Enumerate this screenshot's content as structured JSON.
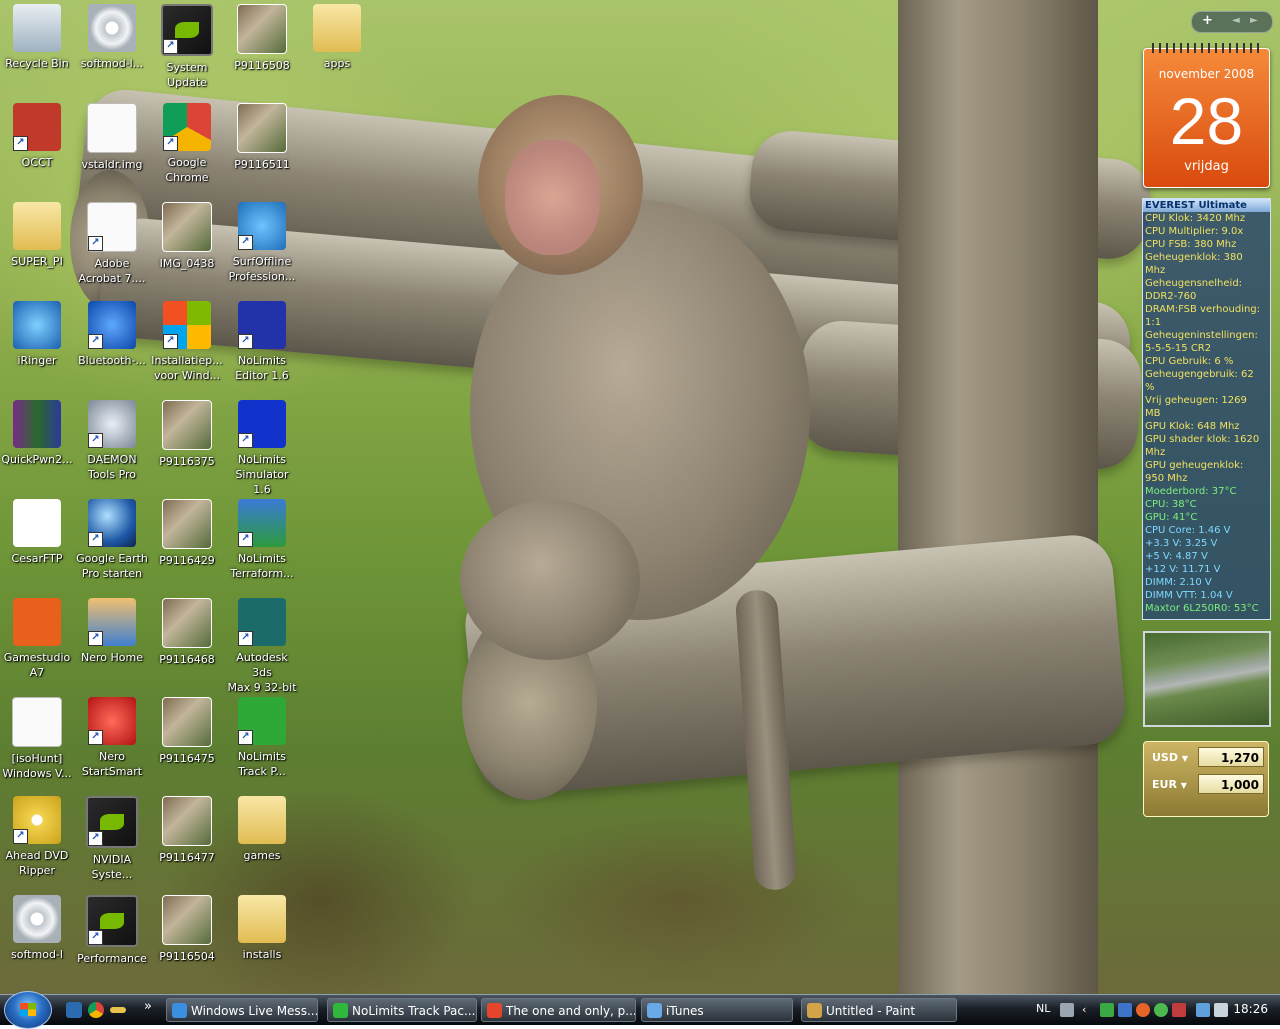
{
  "desktop": {
    "icons": [
      {
        "label": "Recycle Bin"
      },
      {
        "label": "softmod-l..."
      },
      {
        "label": "System\nUpdate"
      },
      {
        "label": "P9116508"
      },
      {
        "label": "apps"
      },
      {
        "label": "OCCT"
      },
      {
        "label": "vstaldr.img"
      },
      {
        "label": "Google\nChrome"
      },
      {
        "label": "P9116511"
      },
      {
        "label": "SUPER_PI"
      },
      {
        "label": "Adobe\nAcrobat 7...."
      },
      {
        "label": "IMG_0438"
      },
      {
        "label": "SurfOffline\nProfession..."
      },
      {
        "label": "iRinger"
      },
      {
        "label": "Bluetooth-..."
      },
      {
        "label": "Installatiep...\nvoor Wind..."
      },
      {
        "label": "NoLimits\nEditor 1.6"
      },
      {
        "label": "QuickPwn2..."
      },
      {
        "label": "DAEMON\nTools Pro"
      },
      {
        "label": "P9116375"
      },
      {
        "label": "NoLimits\nSimulator 1.6"
      },
      {
        "label": "CesarFTP"
      },
      {
        "label": "Google Earth\nPro starten"
      },
      {
        "label": "P9116429"
      },
      {
        "label": "NoLimits\nTerraform..."
      },
      {
        "label": "Gamestudio\nA7"
      },
      {
        "label": "Nero Home"
      },
      {
        "label": "P9116468"
      },
      {
        "label": "Autodesk 3ds\nMax 9 32-bit"
      },
      {
        "label": "[isoHunt]\nWindows V..."
      },
      {
        "label": "Nero\nStartSmart"
      },
      {
        "label": "P9116475"
      },
      {
        "label": "NoLimits\nTrack P..."
      },
      {
        "label": "Ahead DVD\nRipper"
      },
      {
        "label": "NVIDIA\nSyste..."
      },
      {
        "label": "P9116477"
      },
      {
        "label": "games"
      },
      {
        "label": "softmod-l"
      },
      {
        "label": "Performance"
      },
      {
        "label": "P9116504"
      },
      {
        "label": "installs"
      }
    ]
  },
  "calendar": {
    "month": "november 2008",
    "day": "28",
    "weekday": "vrijdag"
  },
  "everest": {
    "title": "EVEREST Ultimate",
    "rows": [
      {
        "text": "CPU Klok: 3420 Mhz",
        "color": "#f0e060"
      },
      {
        "text": "CPU Multiplier: 9.0x",
        "color": "#f0e060"
      },
      {
        "text": "CPU FSB: 380 Mhz",
        "color": "#f0e060"
      },
      {
        "text": "Geheugenklok: 380",
        "color": "#f0e060"
      },
      {
        "text": "Mhz",
        "color": "#f0e060"
      },
      {
        "text": "Geheugensnelheid:",
        "color": "#f0e060"
      },
      {
        "text": "DDR2-760",
        "color": "#f0e060"
      },
      {
        "text": "DRAM:FSB verhouding:",
        "color": "#f0e060"
      },
      {
        "text": "1:1",
        "color": "#f0e060"
      },
      {
        "text": "Geheugeninstellingen:",
        "color": "#f0e060"
      },
      {
        "text": "5-5-5-15 CR2",
        "color": "#f0e060"
      },
      {
        "text": "CPU Gebruik: 6 %",
        "color": "#f0e060"
      },
      {
        "text": "Geheugengebruik: 62",
        "color": "#f0e060"
      },
      {
        "text": "%",
        "color": "#f0e060"
      },
      {
        "text": "Vrij geheugen: 1269",
        "color": "#f0e060"
      },
      {
        "text": "MB",
        "color": "#f0e060"
      },
      {
        "text": "GPU Klok: 648 Mhz",
        "color": "#f0e060"
      },
      {
        "text": "GPU shader klok: 1620",
        "color": "#f0e060"
      },
      {
        "text": "Mhz",
        "color": "#f0e060"
      },
      {
        "text": "GPU geheugenklok:",
        "color": "#f0e060"
      },
      {
        "text": "950 Mhz",
        "color": "#f0e060"
      },
      {
        "text": "Moederbord: 37°C",
        "color": "#7cf07c"
      },
      {
        "text": "CPU: 38°C",
        "color": "#7cf07c"
      },
      {
        "text": "GPU: 41°C",
        "color": "#7cf07c"
      },
      {
        "text": "CPU Core: 1.46 V",
        "color": "#7fd9ff"
      },
      {
        "text": "+3.3 V: 3.25 V",
        "color": "#7fd9ff"
      },
      {
        "text": "+5 V: 4.87 V",
        "color": "#7fd9ff"
      },
      {
        "text": "+12 V: 11.71 V",
        "color": "#7fd9ff"
      },
      {
        "text": "DIMM: 2.10 V",
        "color": "#7fd9ff"
      },
      {
        "text": "DIMM VTT: 1.04 V",
        "color": "#7fd9ff"
      },
      {
        "text": "Maxtor 6L250R0: 53°C",
        "color": "#7cf07c"
      }
    ]
  },
  "sidebar_controls": {
    "add": "+",
    "prev": "◄",
    "next": "►"
  },
  "currency": {
    "rows": [
      {
        "code": "USD",
        "arrow": "▼",
        "value": "1,270"
      },
      {
        "code": "EUR",
        "arrow": "▼",
        "value": "1,000"
      }
    ]
  },
  "taskbar": {
    "quicklaunch_more": "»",
    "tasks": [
      {
        "label": "Windows Live Mess...",
        "color": "#3b8fe0"
      },
      {
        "label": "NoLimits Track Pac...",
        "color": "#2fb83b"
      },
      {
        "label": "The one and only, p...",
        "color": "#e6452b"
      },
      {
        "label": "iTunes",
        "color": "#6aa9e8"
      },
      {
        "label": "Untitled - Paint",
        "color": "#d3a34a"
      }
    ],
    "tray": {
      "language": "NL",
      "clock": "18:26"
    }
  }
}
